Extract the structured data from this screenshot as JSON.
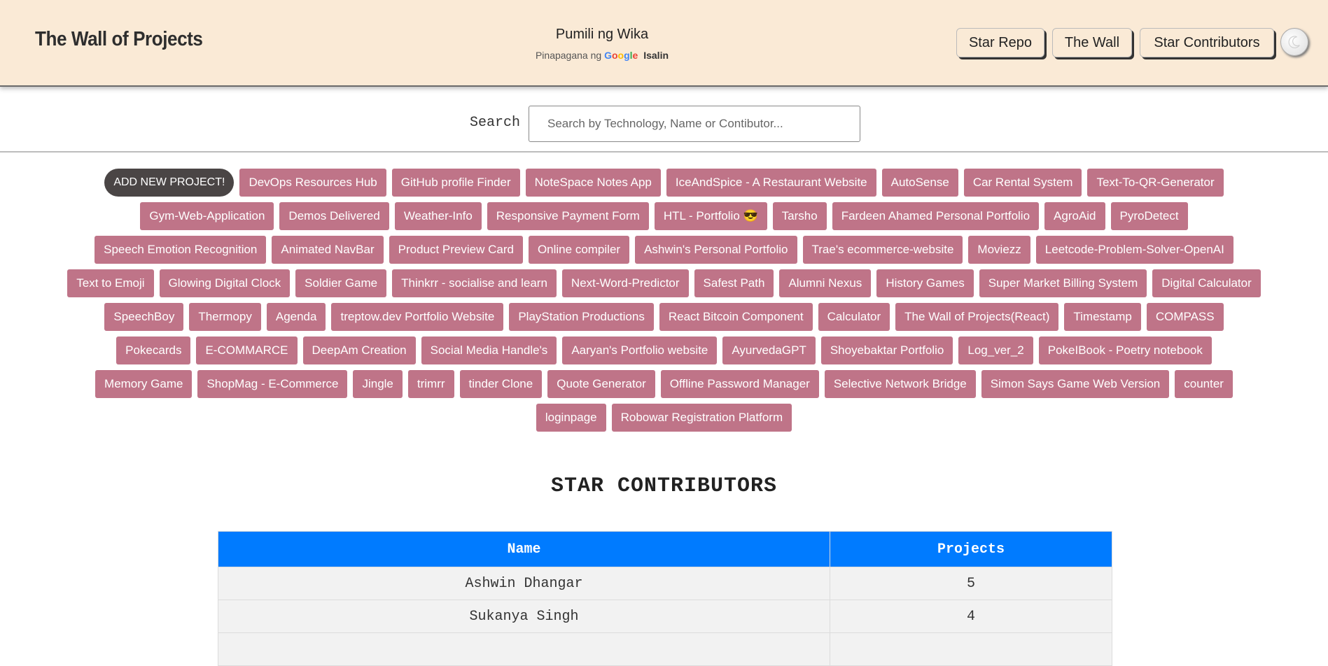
{
  "header": {
    "brand": "The Wall of Projects",
    "translate": {
      "language_select": "Pumili ng Wika",
      "powered_by": "Pinapagana ng",
      "google": [
        "G",
        "o",
        "o",
        "g",
        "l",
        "e"
      ],
      "translate_link": "Isalin"
    },
    "nav": {
      "star_repo": "Star Repo",
      "the_wall": "The Wall",
      "star_contributors": "Star Contributors"
    },
    "theme_toggle_icon": "moon-icon"
  },
  "search": {
    "label": "Search",
    "placeholder": "Search by Technology, Name or Contibutor...",
    "value": ""
  },
  "tags": [
    [
      "ADD NEW PROJECT!",
      "DevOps Resources Hub",
      "GitHub profile Finder",
      "NoteSpace Notes App",
      "IceAndSpice - A Restaurant Website",
      "AutoSense",
      "Car Rental System",
      "Text-To-QR-Generator"
    ],
    [
      "Gym-Web-Application",
      "Demos Delivered",
      "Weather-Info",
      "Responsive Payment Form",
      "HTL - Portfolio 😎",
      "Tarsho",
      "Fardeen Ahamed Personal Portfolio",
      "AgroAid",
      "PyroDetect"
    ],
    [
      "Speech Emotion Recognition",
      "Animated NavBar",
      "Product Preview Card",
      "Online compiler",
      "Ashwin's Personal Portfolio",
      "Trae's ecommerce-website",
      "Moviezz",
      "Leetcode-Problem-Solver-OpenAI"
    ],
    [
      "Text to Emoji",
      "Glowing Digital Clock",
      "Soldier Game",
      "Thinkrr - socialise and learn",
      "Next-Word-Predictor",
      "Safest Path",
      "Alumni Nexus",
      "History Games",
      "Super Market Billing System",
      "Digital Calculator"
    ],
    [
      "SpeechBoy",
      "Thermopy",
      "Agenda",
      "treptow.dev Portfolio Website",
      "PlayStation Productions",
      "React Bitcoin Component",
      "Calculator",
      "The Wall of Projects(React)",
      "Timestamp",
      "COMPASS"
    ],
    [
      "Pokecards",
      "E-COMMARCE",
      "DeepAm Creation",
      "Social Media Handle's",
      "Aaryan's Portfolio website",
      "AyurvedaGPT",
      "Shoyebaktar Portfolio",
      "Log_ver_2",
      "PokeIBook - Poetry notebook"
    ],
    [
      "Memory Game",
      "ShopMag - E-Commerce",
      "Jingle",
      "trimrr",
      "tinder Clone",
      "Quote Generator",
      "Offline Password Manager",
      "Selective Network Bridge",
      "Simon Says Game Web Version",
      "counter"
    ],
    [
      "loginpage",
      "Robowar Registration Platform"
    ]
  ],
  "star_contributors": {
    "title": "STAR CONTRIBUTORS",
    "columns": [
      "Name",
      "Projects"
    ],
    "rows": [
      [
        "Ashwin Dhangar",
        "5"
      ],
      [
        "Sukanya Singh",
        "4"
      ],
      [
        "",
        ""
      ]
    ]
  },
  "colors": {
    "header_bg": "#faead6",
    "tag_bg": "#bf7488",
    "add_tag_bg": "#4a4545",
    "table_header_bg": "#007bff"
  }
}
